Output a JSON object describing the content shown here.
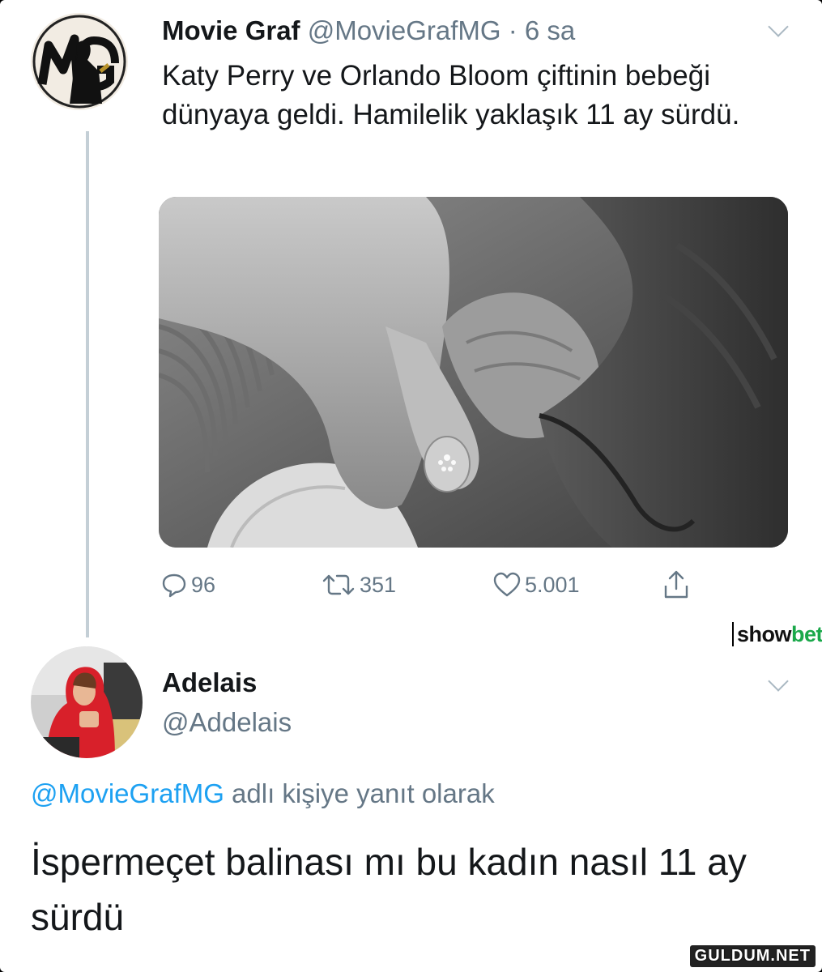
{
  "tweet1": {
    "display_name": "Movie Graf",
    "handle_time": "@MovieGrafMG · 6 sa",
    "avatar_text": "MG",
    "text": "Katy Perry ve Orlando Bloom çiftinin bebeği dünyaya geldi. Hamilelik yaklaşık 11 ay sürdü.",
    "actions": {
      "reply_count": "96",
      "retweet_count": "351",
      "like_count": "5.001"
    }
  },
  "tweet2": {
    "display_name": "Adelais",
    "handle": "@Addelais",
    "reply_to_handle": "@MovieGrafMG",
    "reply_to_suffix": " adlı kişiye yanıt olarak",
    "text": "İspermeçet balinası mı bu kadın nasıl 11 ay sürdü"
  },
  "watermarks": {
    "showbet_part1": "show",
    "showbet_part2": "bet",
    "guldum": "GULDUM.NET"
  },
  "icons": {
    "reply": "reply-icon",
    "retweet": "retweet-icon",
    "like": "heart-icon",
    "share": "share-icon",
    "caret": "chevron-down-icon"
  },
  "colors": {
    "text": "#14171a",
    "muted": "#657786",
    "link": "#1da1f2",
    "thread_line": "#c4cfd6",
    "showbet_green": "#1aa84a",
    "avatar2_red": "#d8202a"
  }
}
